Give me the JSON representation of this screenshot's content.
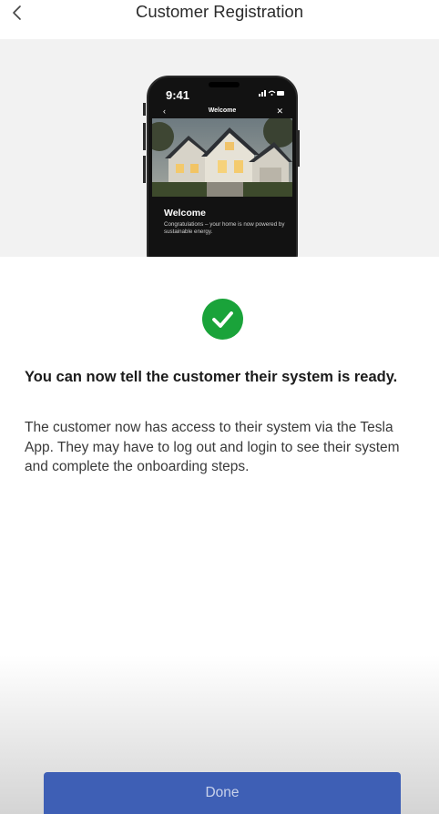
{
  "header": {
    "title": "Customer Registration",
    "back_icon": "chevron-left-icon"
  },
  "hero": {
    "phone": {
      "status_time": "9:41",
      "screen_title": "Welcome",
      "welcome_heading": "Welcome",
      "welcome_body": "Congratulations – your home is now powered by sustainable energy."
    }
  },
  "success": {
    "icon": "checkmark-icon",
    "icon_color": "#1aa33a",
    "heading": "You can now tell the customer their system is ready.",
    "body": "The customer now has access to their system via the Tesla App. They may have to log out and login to see their system and complete the onboarding steps."
  },
  "footer": {
    "done_label": "Done",
    "button_color": "#3e5fb5"
  }
}
